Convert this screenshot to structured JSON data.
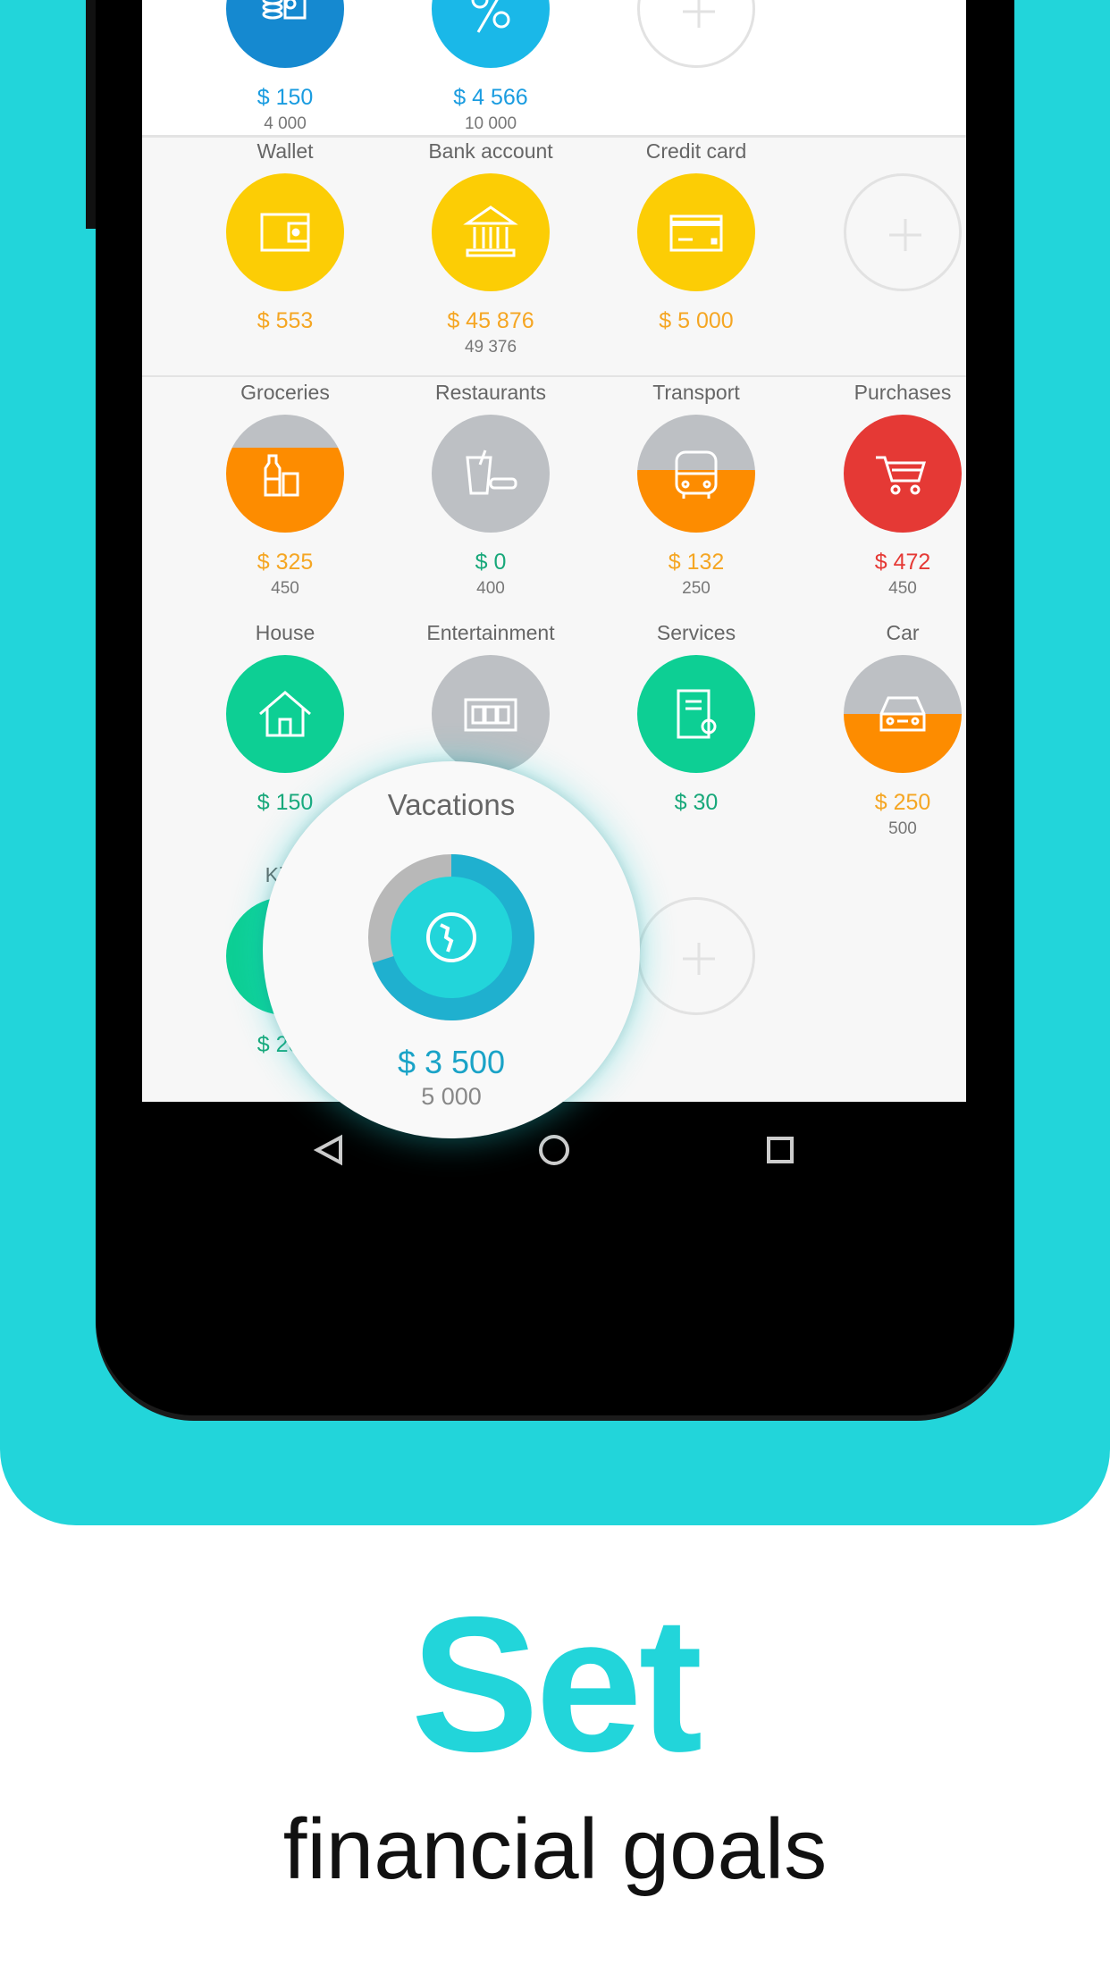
{
  "colors": {
    "accent": "#22d5da",
    "blue": "#1a9ce0",
    "yellow": "#fccd05",
    "orange": "#fd8c00",
    "green": "#0dcf94",
    "red": "#e53935",
    "gray": "#bdc0c4"
  },
  "top_row": [
    {
      "label": "",
      "icon": "coins-icon",
      "amount": "$ 150",
      "sub": "4 000",
      "color": "#1589d0",
      "amount_color": "#1a9ce0"
    },
    {
      "label": "",
      "icon": "percent-icon",
      "amount": "$ 4 566",
      "sub": "10 000",
      "color": "#1ab8e8",
      "amount_color": "#1a9ce0"
    },
    {
      "label": "",
      "icon": "add-icon",
      "add": true
    }
  ],
  "accounts": [
    {
      "label": "Wallet",
      "icon": "wallet-icon",
      "amount": "$ 553",
      "sub": "",
      "color": "#fccd05",
      "amount_color": "#f5a623"
    },
    {
      "label": "Bank account",
      "icon": "bank-icon",
      "amount": "$ 45 876",
      "sub": "49 376",
      "color": "#fccd05",
      "amount_color": "#f5a623"
    },
    {
      "label": "Credit card",
      "icon": "credit-card-icon",
      "amount": "$ 5 000",
      "sub": "",
      "color": "#fccd05",
      "amount_color": "#f5a623"
    },
    {
      "label": "",
      "icon": "add-icon",
      "add": true
    }
  ],
  "expenses": [
    {
      "label": "Groceries",
      "icon": "groceries-icon",
      "amount": "$ 325",
      "sub": "450",
      "color": "#fd8c00",
      "progress": 0.72,
      "amount_color": "#f5a623"
    },
    {
      "label": "Restaurants",
      "icon": "restaurant-icon",
      "amount": "$ 0",
      "sub": "400",
      "color": "#bdc0c4",
      "progress": 0,
      "amount_color": "#18a87a"
    },
    {
      "label": "Transport",
      "icon": "bus-icon",
      "amount": "$ 132",
      "sub": "250",
      "color": "#fd8c00",
      "progress": 0.53,
      "amount_color": "#f5a623"
    },
    {
      "label": "Purchases",
      "icon": "cart-icon",
      "amount": "$ 472",
      "sub": "450",
      "color": "#e53935",
      "progress": 1,
      "amount_color": "#e53935"
    },
    {
      "label": "House",
      "icon": "house-icon",
      "amount": "$ 150",
      "sub": "",
      "color": "#0dcf94",
      "progress": 1,
      "amount_color": "#18a87a"
    },
    {
      "label": "Entertainment",
      "icon": "film-icon",
      "amount": "",
      "sub": "",
      "color": "#bdc0c4",
      "progress": 0,
      "amount_color": "#18a87a"
    },
    {
      "label": "Services",
      "icon": "document-icon",
      "amount": "$ 30",
      "sub": "",
      "color": "#0dcf94",
      "progress": 1,
      "amount_color": "#18a87a"
    },
    {
      "label": "Car",
      "icon": "car-icon",
      "amount": "$ 250",
      "sub": "500",
      "color": "#fd8c00",
      "progress": 0.5,
      "amount_color": "#f5a623"
    },
    {
      "label": "Kids",
      "icon": "baby-icon",
      "amount": "$ 200",
      "sub": "",
      "color": "#0dcf94",
      "progress": 1,
      "amount_color": "#18a87a"
    },
    {
      "label": "",
      "icon": "globe-icon",
      "amount": "",
      "sub": "",
      "color": "#22d5da",
      "progress": 1
    },
    {
      "label": "",
      "icon": "add-icon",
      "add": true
    }
  ],
  "popup": {
    "title": "Vacations",
    "icon": "globe-icon",
    "amount": "$ 3 500",
    "sub": "5 000",
    "progress": 0.7
  },
  "nav": {
    "back": "back-icon",
    "home": "home-icon",
    "recents": "recents-icon"
  },
  "headline": "Set",
  "subheadline": "financial goals"
}
